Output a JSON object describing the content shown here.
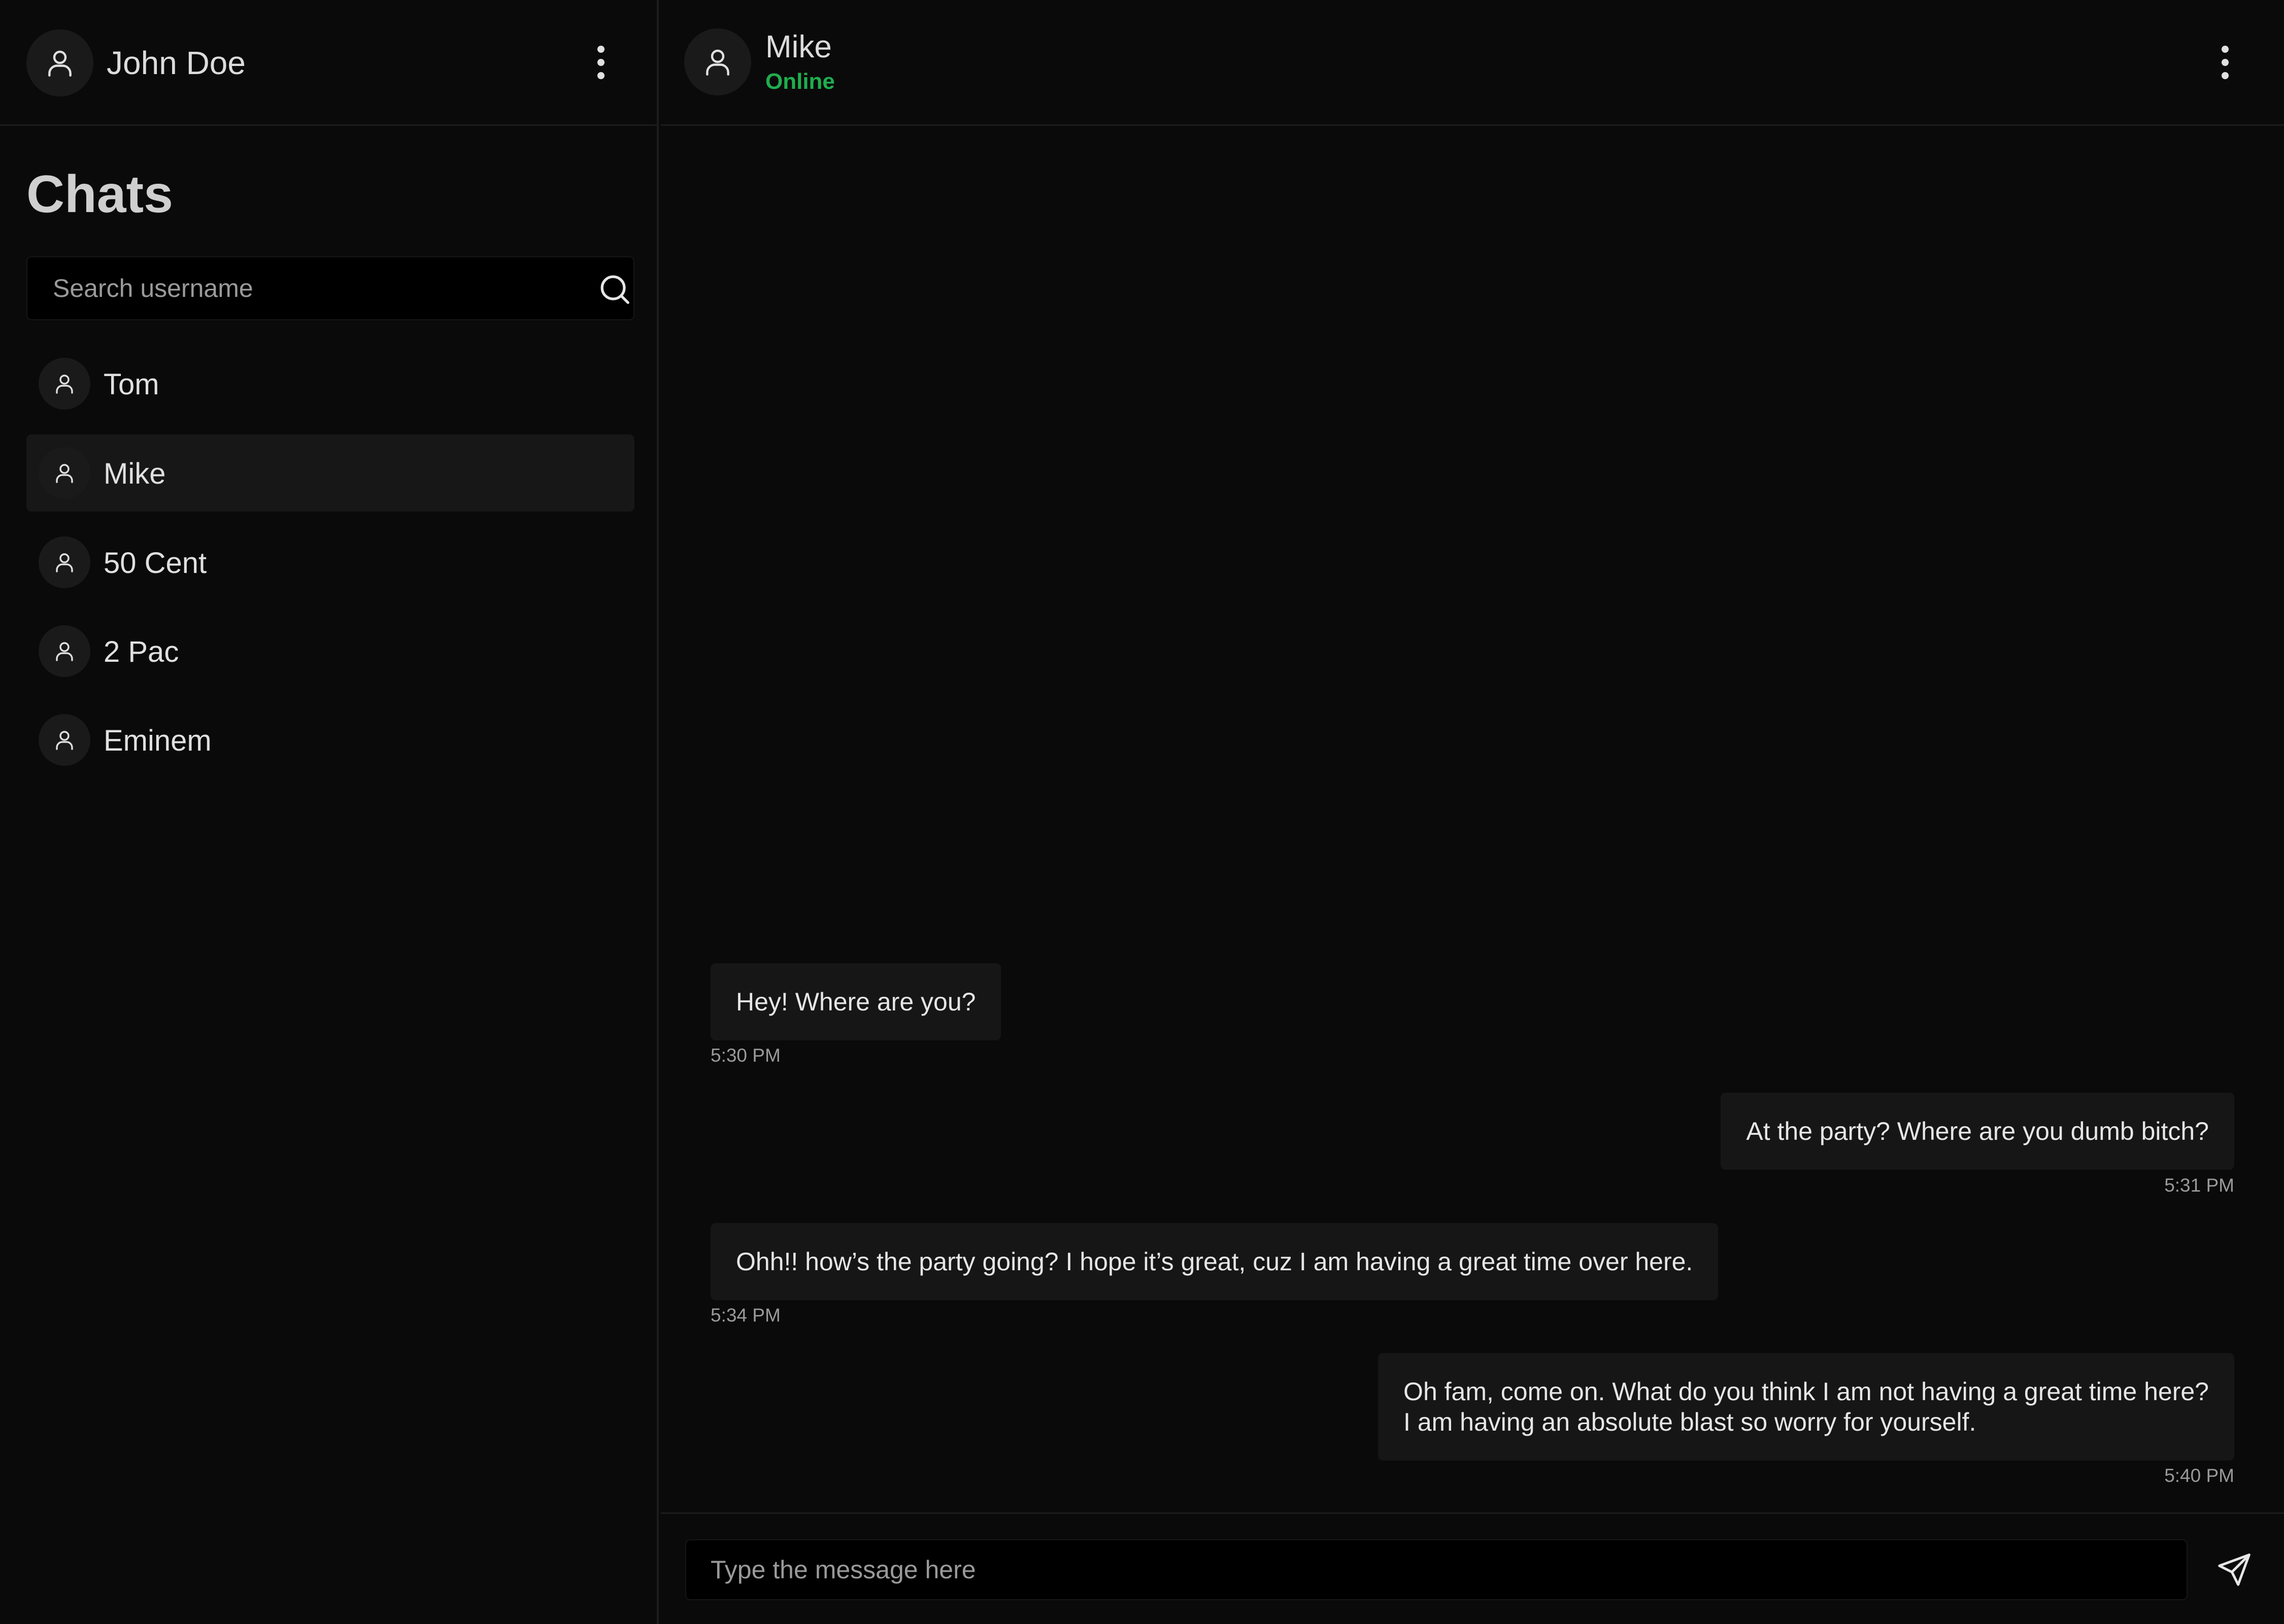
{
  "sidebar": {
    "user_name": "John Doe",
    "title": "Chats",
    "search_placeholder": "Search username",
    "chats": [
      {
        "name": "Tom",
        "active": false
      },
      {
        "name": "Mike",
        "active": true
      },
      {
        "name": "50 Cent",
        "active": false
      },
      {
        "name": "2 Pac",
        "active": false
      },
      {
        "name": "Eminem",
        "active": false
      }
    ]
  },
  "conversation": {
    "contact_name": "Mike",
    "status": "Online",
    "messages": [
      {
        "direction": "incoming",
        "text": "Hey! Where are you?",
        "time": "5:30 PM"
      },
      {
        "direction": "outgoing",
        "text": "At the party? Where are you dumb bitch?",
        "time": "5:31 PM"
      },
      {
        "direction": "incoming",
        "text": "Ohh!! how’s the party going? I hope it’s great, cuz I am having a great time over here.",
        "time": "5:34 PM"
      },
      {
        "direction": "outgoing",
        "text": "Oh fam, come on. What do you think I am not having a great time here?\nI am having an absolute blast so worry for yourself.",
        "time": "5:40 PM"
      }
    ],
    "composer_placeholder": "Type the message here"
  },
  "icons": {
    "user": "user-icon",
    "menu": "more-vertical-icon",
    "search": "search-icon",
    "send": "send-icon"
  },
  "colors": {
    "background": "#0a0a0a",
    "bubble": "#161616",
    "online": "#1fae4f"
  }
}
